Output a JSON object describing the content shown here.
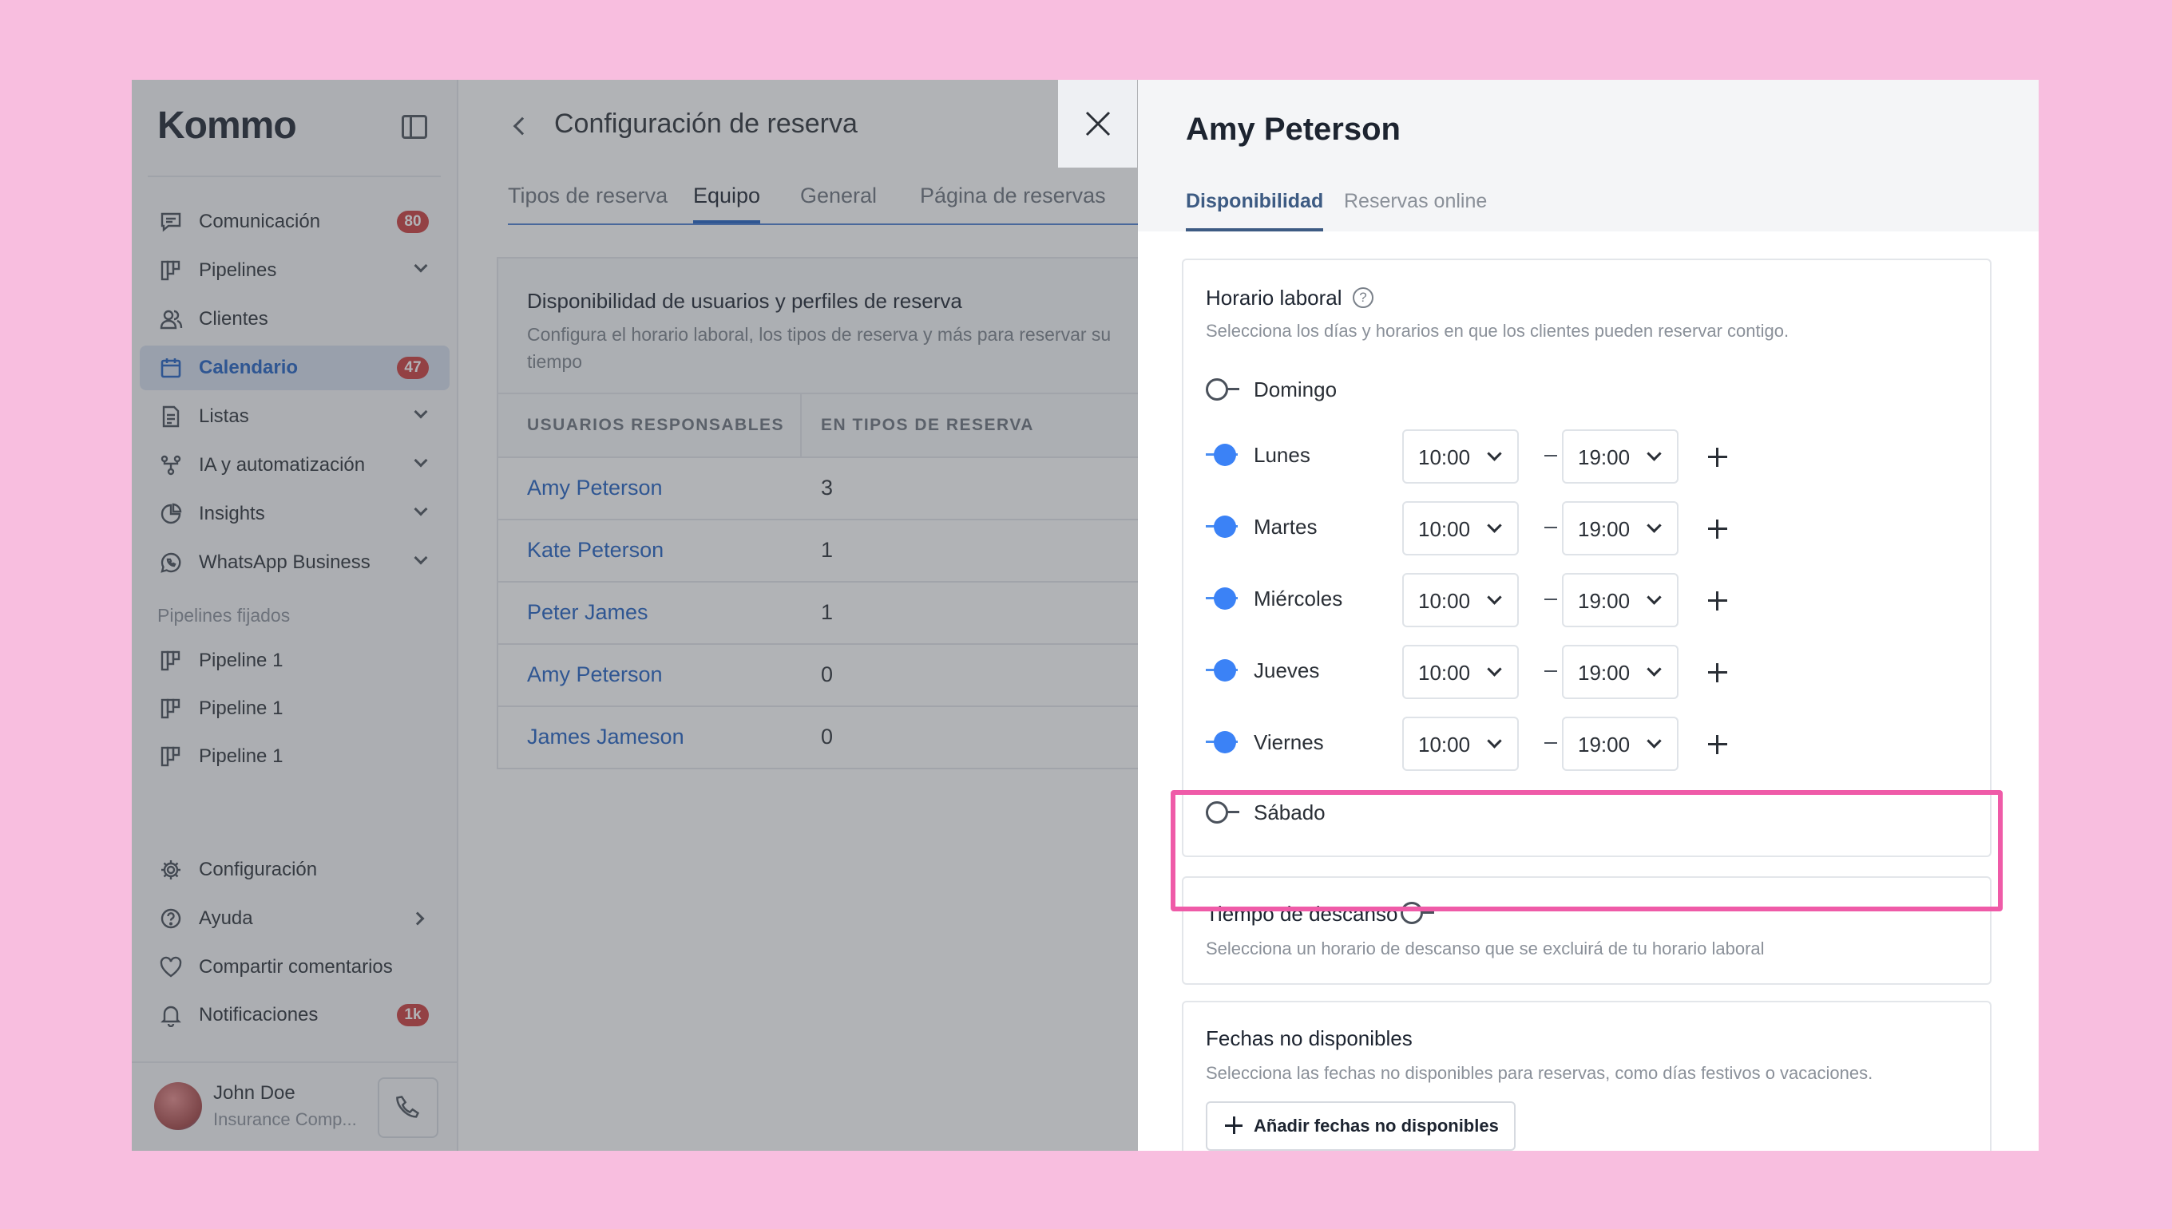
{
  "sidebar": {
    "logo": "Kommo",
    "nav": [
      {
        "label": "Comunicación",
        "badge": "80",
        "icon": "chat-icon"
      },
      {
        "label": "Pipelines",
        "icon": "pipeline-icon"
      },
      {
        "label": "Clientes",
        "icon": "users-icon"
      },
      {
        "label": "Calendario",
        "badge": "47",
        "icon": "calendar-icon",
        "active": true
      },
      {
        "label": "Listas",
        "icon": "list-icon"
      },
      {
        "label": "IA y automatización",
        "icon": "automation-icon"
      },
      {
        "label": "Insights",
        "icon": "chart-pie-icon"
      },
      {
        "label": "WhatsApp Business",
        "icon": "whatsapp-icon"
      }
    ],
    "pinned_heading": "Pipelines fijados",
    "pinned": [
      {
        "label": "Pipeline 1"
      },
      {
        "label": "Pipeline 1"
      },
      {
        "label": "Pipeline 1"
      }
    ],
    "bottom": [
      {
        "label": "Configuración",
        "icon": "gear-icon"
      },
      {
        "label": "Ayuda",
        "icon": "help-icon"
      },
      {
        "label": "Compartir comentarios",
        "icon": "heart-icon"
      },
      {
        "label": "Notificaciones",
        "badge": "1k",
        "icon": "bell-icon"
      }
    ],
    "user": {
      "name": "John Doe",
      "company": "Insurance Comp..."
    }
  },
  "main": {
    "title": "Configuración de reserva",
    "tabs": [
      "Tipos de reserva",
      "Equipo",
      "General",
      "Página de reservas"
    ],
    "active_tab": "Equipo",
    "panel": {
      "title": "Disponibilidad de usuarios y perfiles de reserva",
      "description": "Configura el horario laboral, los tipos de reserva y más para reservar su tiempo",
      "columns": [
        "USUARIOS RESPONSABLES",
        "EN TIPOS DE RESERVA"
      ],
      "rows": [
        {
          "name": "Amy Peterson",
          "count": "3"
        },
        {
          "name": "Kate Peterson",
          "count": "1"
        },
        {
          "name": "Peter James",
          "count": "1"
        },
        {
          "name": "Amy Peterson",
          "count": "0"
        },
        {
          "name": "James Jameson",
          "count": "0"
        }
      ]
    }
  },
  "drawer": {
    "title": "Amy Peterson",
    "tabs": [
      "Disponibilidad",
      "Reservas online"
    ],
    "active_tab": "Disponibilidad",
    "working_hours": {
      "title": "Horario laboral",
      "description": "Selecciona los días y horarios en que los clientes pueden reservar contigo.",
      "days": [
        {
          "name": "Domingo",
          "enabled": false
        },
        {
          "name": "Lunes",
          "enabled": true,
          "from": "10:00",
          "to": "19:00"
        },
        {
          "name": "Martes",
          "enabled": true,
          "from": "10:00",
          "to": "19:00"
        },
        {
          "name": "Miércoles",
          "enabled": true,
          "from": "10:00",
          "to": "19:00"
        },
        {
          "name": "Jueves",
          "enabled": true,
          "from": "10:00",
          "to": "19:00"
        },
        {
          "name": "Viernes",
          "enabled": true,
          "from": "10:00",
          "to": "19:00"
        },
        {
          "name": "Sábado",
          "enabled": false
        }
      ]
    },
    "break_time": {
      "title": "Tiempo de descanso",
      "enabled": false,
      "description": "Selecciona un horario de descanso que se excluirá de tu horario laboral"
    },
    "unavailable_dates": {
      "title": "Fechas no disponibles",
      "description": "Selecciona las fechas no disponibles para reservas, como días festivos o vacaciones.",
      "button": "Añadir fechas no disponibles"
    }
  },
  "colors": {
    "background": "#f8bedf",
    "accent": "#1f5fc2",
    "toggle_on": "#3b82f6",
    "badge": "#cc3b3b",
    "highlight": "#ef5ba8"
  }
}
